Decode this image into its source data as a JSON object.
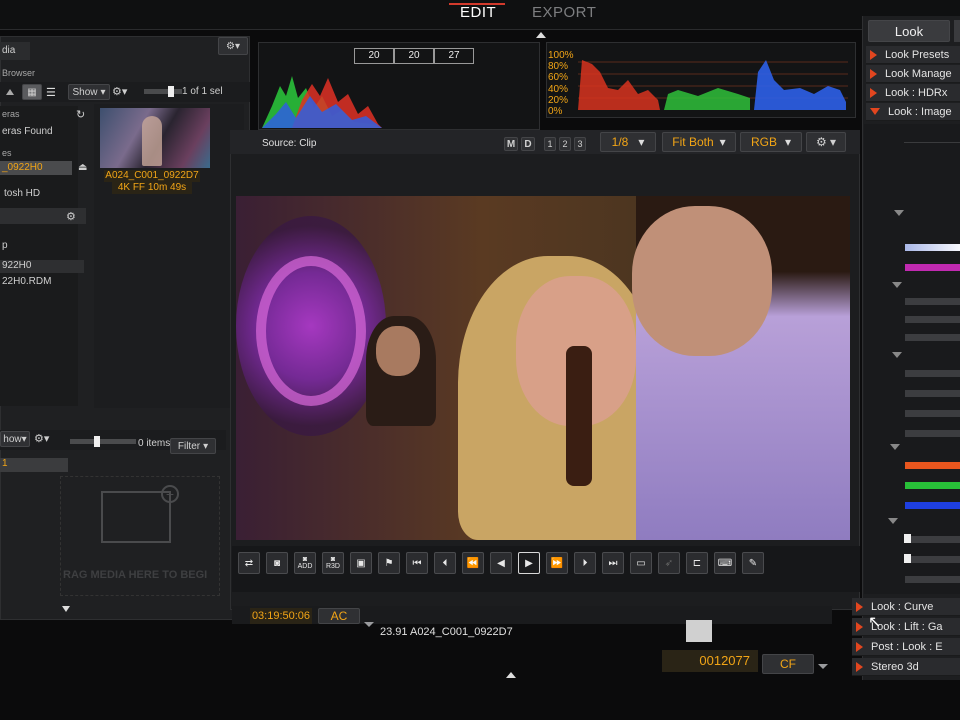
{
  "topbar": {
    "edit": "EDIT",
    "export": "EXPORT"
  },
  "left": {
    "media_label": "dia",
    "browser_label": "Browser",
    "show_label": "Show",
    "sel_count": "1 of 1 sel",
    "cameras_label": "eras",
    "cameras_found": "eras Found",
    "drives_label": "es",
    "selected_folder": "_0922H0",
    "macintosh": "tosh HD",
    "p_label": "p",
    "folder2": "922H0",
    "rdm_file": "22H0.RDM",
    "clip_name": "A024_C001_0922D7",
    "clip_info": "4K FF   10m 49s",
    "bottom_show": "how",
    "items_label": "0 items",
    "filter_label": "Filter",
    "bin_row": "1",
    "drop_hint": "RAG MEDIA HERE TO BEGI"
  },
  "scopes": {
    "rgb_values": [
      "20",
      "20",
      "27"
    ],
    "percent_ticks": [
      "100%",
      "80%",
      "60%",
      "40%",
      "20%",
      "0%"
    ]
  },
  "viewer": {
    "source_label": "Source: Clip",
    "m_label": "M",
    "d_label": "D",
    "pages": [
      "1",
      "2",
      "3"
    ],
    "resolution": "1/8",
    "fit": "Fit Both",
    "color_mode": "RGB"
  },
  "transport": {
    "add_label": "ADD",
    "r3d_label": "R3D"
  },
  "timecode": {
    "tc": "03:19:50:06",
    "ac": "AC",
    "clip_fps": "23.91  A024_C001_0922D7",
    "frame": "0012077",
    "cf": "CF"
  },
  "right": {
    "tab_look": "Look",
    "items": [
      "Look Presets",
      "Look Manage",
      "Look : HDRx",
      "Look : Image"
    ],
    "bottom_items": [
      "Look : Curve",
      "Look : Lift : Ga",
      "Post : Look : E",
      "Stereo 3d"
    ]
  },
  "colors": {
    "accent": "#f2a516",
    "tab_red": "#d33a2c",
    "arrow_red": "#e2461f"
  }
}
